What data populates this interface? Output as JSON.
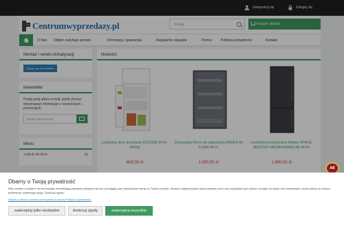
{
  "topbar": {
    "register": "Zarejestruj się",
    "login": "Zaloguj się"
  },
  "header": {
    "logo_text": "Centrumwyprzedazy.pl",
    "search_placeholder": "Szukaj",
    "cart_label": "Koszyk: (pusty)"
  },
  "nav": {
    "items": [
      "O Nas",
      "Odbiór zużytego sprzętu",
      "Informacje i gwarancja",
      "Regulamin zakupów",
      "Pomoc",
      "Polityka prywatności",
      "Kontakt"
    ]
  },
  "side": {
    "service_title": "Montaż i serwis klimatyzacji",
    "service_button": "Zakup nas na Otomoto",
    "newsletter_title": "Newsletter",
    "newsletter_text": "Podaj swój adres e-mail, jeżeli chcesz otrzymywać informacje o nowościach i promocjach.",
    "newsletter_placeholder": "Wpisz adres e-mail",
    "menu_title": "Menu",
    "menu_item": "Artykuły dla domu",
    "menu_count": "(3)"
  },
  "main": {
    "title": "Nowości",
    "products": [
      {
        "name": "Lodówka dwu drzwiowa KGC390-30-E-DAGE",
        "price": "600,00 zł"
      },
      {
        "name": "Zmywarka 60cm do zabudowy MIDEA SI 3.60N Wi-Fi",
        "price": "1 000,00 zł"
      },
      {
        "name": "Lodówka inwertorowa Midea SPACE MASTER MERB445M6C4B Wi-Fi",
        "price": "1 800,00 zł"
      }
    ]
  },
  "cookie": {
    "title": "Dbamy o Twoją prywatność",
    "body": "Pliki cookies i podobne im technologie umożliwiają poprawne działanie strony i pomagają nam dostosować ofertę do Twoich potrzeb. Możesz zaakceptować wykorzystanie przez nas wszystkich tych plików i przejść do sklepu lub dostosować użycie plików do swoich preferencji, wybierając opcję \"Dostosuj zgody\".",
    "link": "Więcej o plikach cookies przeczytasz w naszej Polityce prywatności.",
    "btn_necessary": "zaakceptuj tylko niezbędne",
    "btn_adjust": "dostosuj zgody",
    "btn_all": "zaakceptuj wszystkie"
  },
  "badge": {
    "label": "AB"
  },
  "colors": {
    "accent": "#3f9a5e",
    "link": "#2f7fb5",
    "price": "#cc3333"
  }
}
